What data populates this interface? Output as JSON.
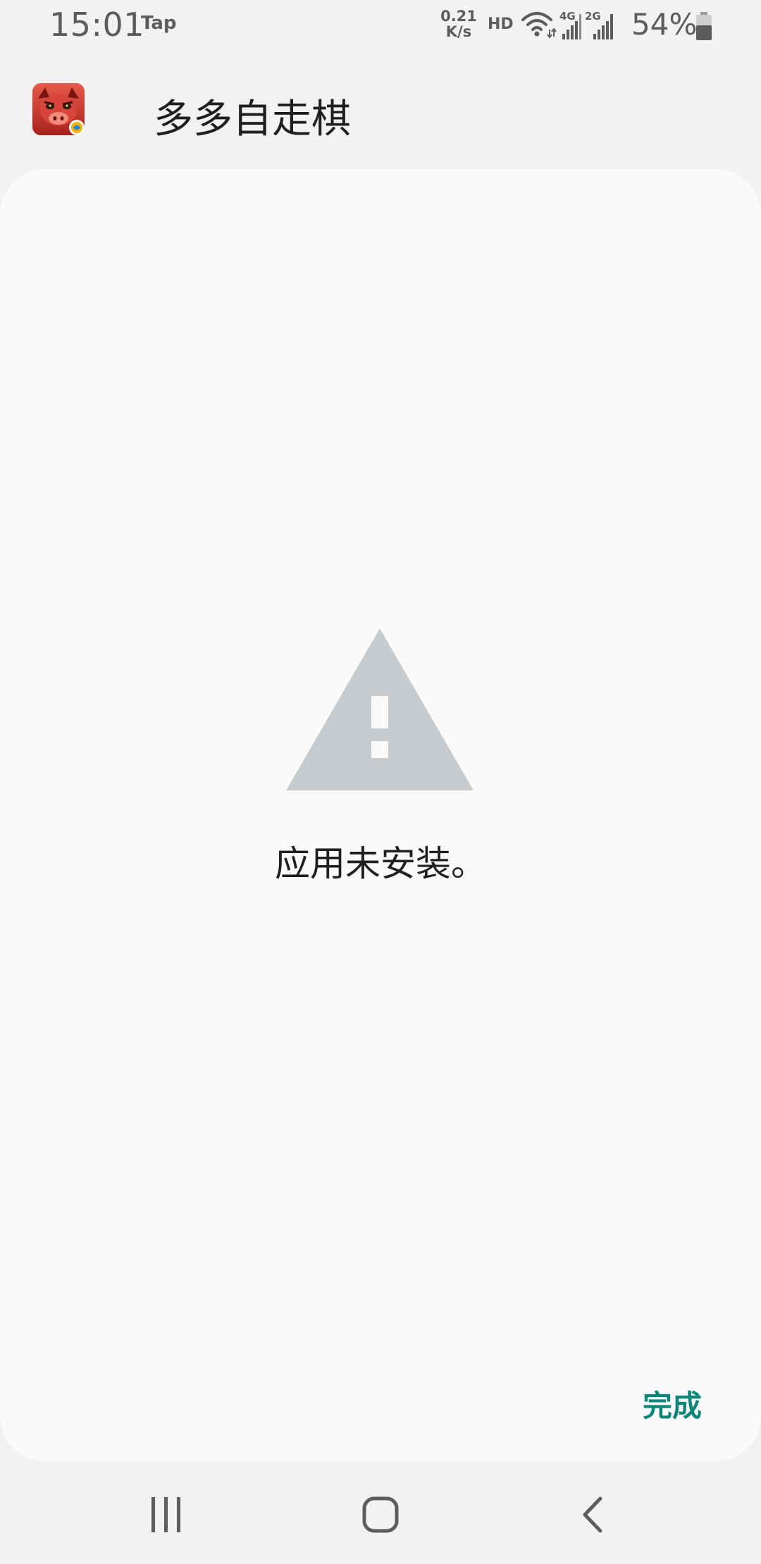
{
  "status_bar": {
    "time": "15:01",
    "notification_app": "Tap",
    "net_speed_value": "0.21",
    "net_speed_unit": "K/s",
    "hd_label": "HD",
    "signal_label_1": "4G",
    "signal_label_2": "2G",
    "battery_percent": "54%"
  },
  "header": {
    "app_name": "多多自走棋"
  },
  "dialog": {
    "message": "应用未安装。",
    "done_label": "完成"
  },
  "colors": {
    "accent": "#0c8579",
    "warning_icon": "#c8cbcd",
    "card_background": "#fafafa",
    "page_background": "#f2f2f2"
  },
  "icons": {
    "warning": "warning-triangle-icon",
    "wifi": "wifi-icon",
    "signal": "cell-signal-icon",
    "battery": "battery-icon",
    "recents": "recent-apps-icon",
    "home": "home-icon",
    "back": "back-icon"
  }
}
